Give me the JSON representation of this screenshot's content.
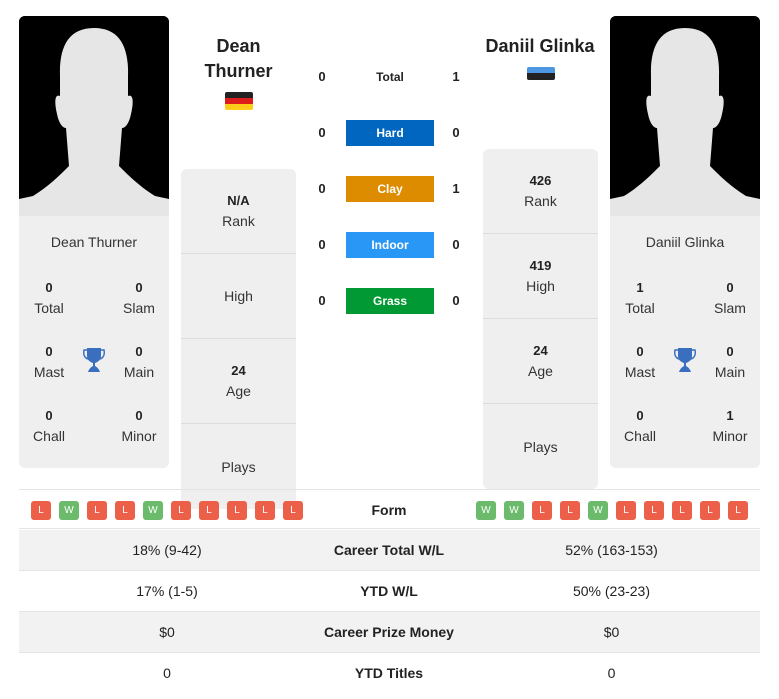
{
  "players": {
    "left": {
      "name": "Dean Thurner",
      "name_line1": "Dean",
      "name_line2": "Thurner",
      "flag": "germany-flag",
      "flag_colors": [
        "#222222",
        "#dd1c1c",
        "#ffcc1a"
      ],
      "titles": {
        "total": {
          "value": "0",
          "label": "Total"
        },
        "slam": {
          "value": "0",
          "label": "Slam"
        },
        "mast": {
          "value": "0",
          "label": "Mast"
        },
        "main": {
          "value": "0",
          "label": "Main"
        },
        "chall": {
          "value": "0",
          "label": "Chall"
        },
        "minor": {
          "value": "0",
          "label": "Minor"
        }
      },
      "info": {
        "rank": {
          "value": "N/A",
          "label": "Rank"
        },
        "high": {
          "value": "",
          "label": "High"
        },
        "age": {
          "value": "24",
          "label": "Age"
        },
        "plays": {
          "value": "",
          "label": "Plays"
        }
      },
      "form": [
        "L",
        "W",
        "L",
        "L",
        "W",
        "L",
        "L",
        "L",
        "L",
        "L"
      ]
    },
    "right": {
      "name": "Daniil Glinka",
      "flag": "estonia-flag",
      "flag_colors": [
        "#4d97e0",
        "#222222",
        "#ffffff"
      ],
      "titles": {
        "total": {
          "value": "1",
          "label": "Total"
        },
        "slam": {
          "value": "0",
          "label": "Slam"
        },
        "mast": {
          "value": "0",
          "label": "Mast"
        },
        "main": {
          "value": "0",
          "label": "Main"
        },
        "chall": {
          "value": "0",
          "label": "Chall"
        },
        "minor": {
          "value": "1",
          "label": "Minor"
        }
      },
      "info": {
        "rank": {
          "value": "426",
          "label": "Rank"
        },
        "high": {
          "value": "419",
          "label": "High"
        },
        "age": {
          "value": "24",
          "label": "Age"
        },
        "plays": {
          "value": "",
          "label": "Plays"
        }
      },
      "form": [
        "W",
        "W",
        "L",
        "L",
        "W",
        "L",
        "L",
        "L",
        "L",
        "L"
      ]
    }
  },
  "h2h": [
    {
      "label": "Total",
      "left": "0",
      "right": "1",
      "color": ""
    },
    {
      "label": "Hard",
      "left": "0",
      "right": "0",
      "color": "#0066c0"
    },
    {
      "label": "Clay",
      "left": "0",
      "right": "1",
      "color": "#dd8c00"
    },
    {
      "label": "Indoor",
      "left": "0",
      "right": "0",
      "color": "#2897f5"
    },
    {
      "label": "Grass",
      "left": "0",
      "right": "0",
      "color": "#009933"
    }
  ],
  "form_label": "Form",
  "stats": [
    {
      "label": "Career Total W/L",
      "left": "18% (9-42)",
      "right": "52% (163-153)"
    },
    {
      "label": "YTD W/L",
      "left": "17% (1-5)",
      "right": "50% (23-23)"
    },
    {
      "label": "Career Prize Money",
      "left": "$0",
      "right": "$0"
    },
    {
      "label": "YTD Titles",
      "left": "0",
      "right": "0"
    }
  ]
}
